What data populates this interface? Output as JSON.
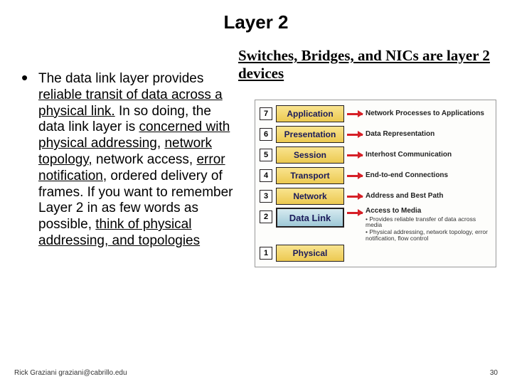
{
  "title": "Layer 2",
  "subtitle": "Switches, Bridges, and NICs are layer 2 devices",
  "body": {
    "seg1": "The data link layer provides ",
    "u1": "reliable transit of data across a physical link.",
    "seg2": " In so doing, the data link layer is ",
    "u2": "concerned with physical addressing",
    "seg3": ", ",
    "u3": "network topology,",
    "seg4": " network access, ",
    "u4": "error notification",
    "seg5": ", ordered delivery of frames. If you want to remember Layer 2 in as few words as possible, ",
    "u5": "think of physical addressing, and topologies"
  },
  "osi": [
    {
      "n": "7",
      "name": "Application",
      "desc": "Network Processes to Applications",
      "hl": false
    },
    {
      "n": "6",
      "name": "Presentation",
      "desc": "Data Representation",
      "hl": false
    },
    {
      "n": "5",
      "name": "Session",
      "desc": "Interhost Communication",
      "hl": false
    },
    {
      "n": "4",
      "name": "Transport",
      "desc": "End-to-end Connections",
      "hl": false
    },
    {
      "n": "3",
      "name": "Network",
      "desc": "Address and Best Path",
      "hl": false
    },
    {
      "n": "2",
      "name": "Data Link",
      "desc": "Access to Media",
      "hl": true,
      "sub1": "Provides reliable transfer of data across media",
      "sub2": "Physical addressing, network topology, error notification, flow control"
    },
    {
      "n": "1",
      "name": "Physical",
      "desc": "",
      "hl": false
    }
  ],
  "footer_left": "Rick Graziani  graziani@cabrillo.edu",
  "footer_right": "30"
}
